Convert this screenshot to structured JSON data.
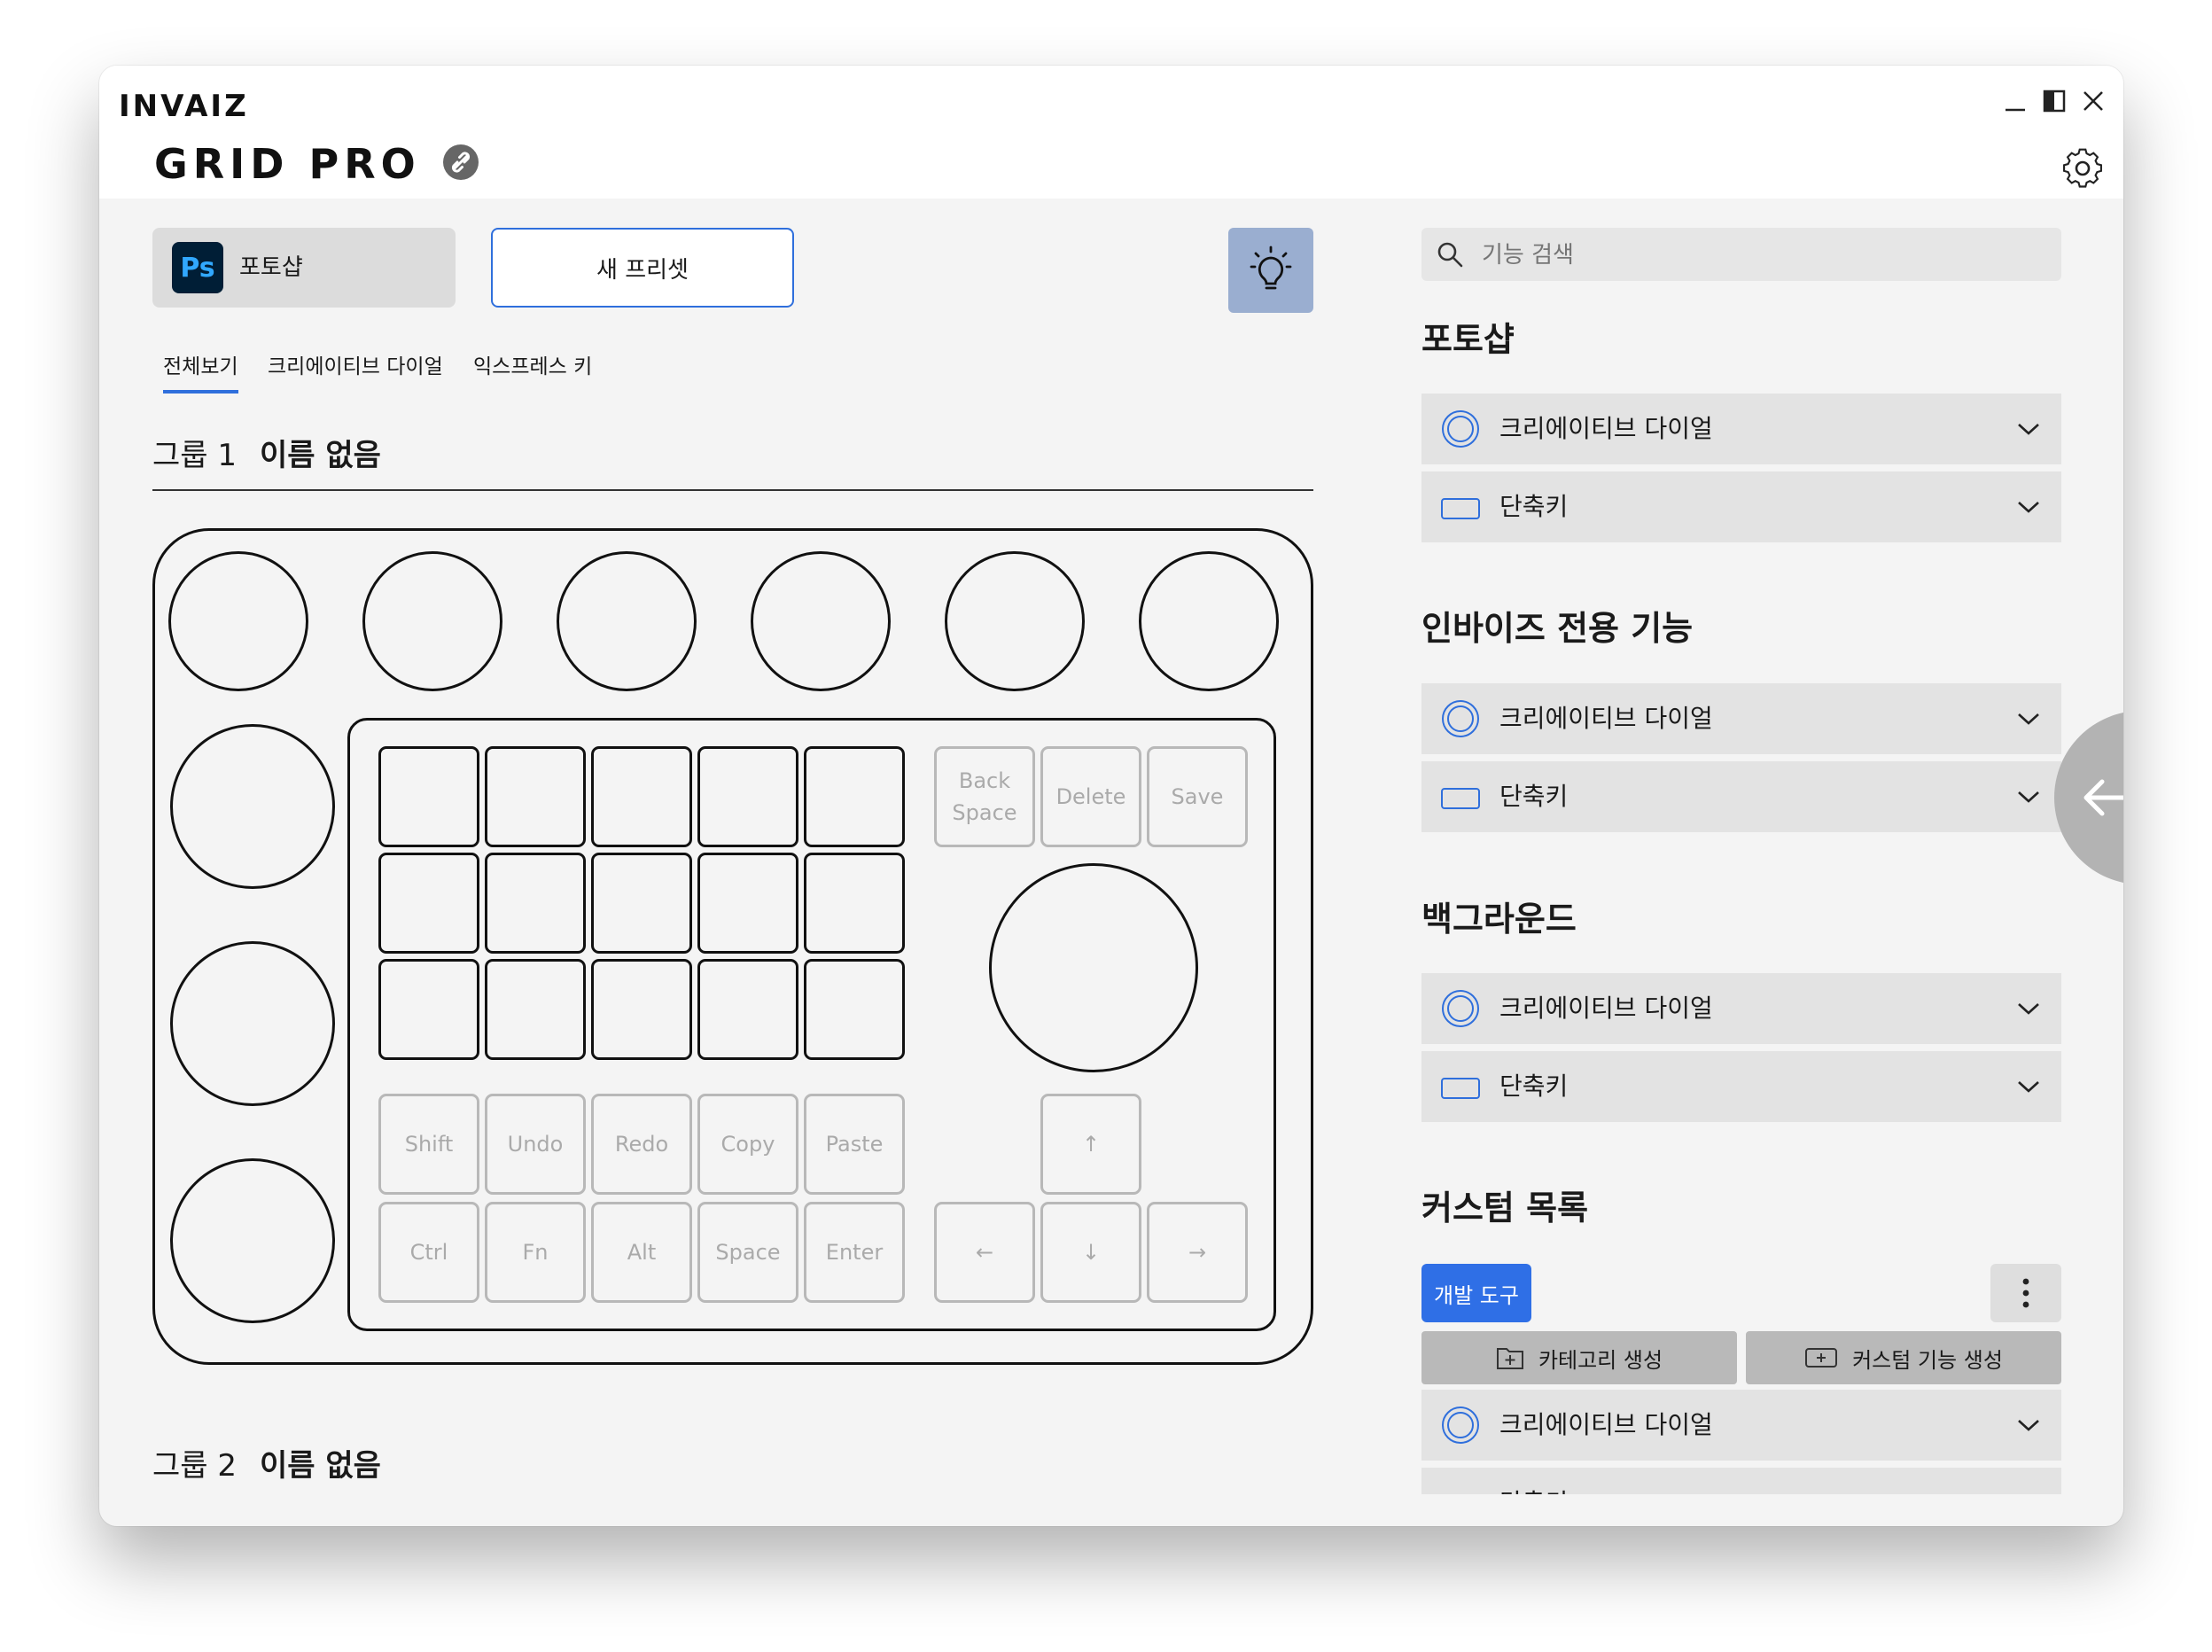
{
  "window": {
    "brand": "INVAIZ",
    "product": "GRID PRO"
  },
  "preset_bar": {
    "app_icon": "Ps",
    "app_label": "포토샵",
    "new_preset_label": "새 프리셋"
  },
  "tabs": [
    {
      "label": "전체보기",
      "active": true
    },
    {
      "label": "크리에이티브 다이얼",
      "active": false
    },
    {
      "label": "익스프레스 키",
      "active": false
    }
  ],
  "groups": [
    {
      "prefix": "그룹 1",
      "name": "이름 없음"
    },
    {
      "prefix": "그룹 2",
      "name": "이름 없음"
    }
  ],
  "device": {
    "function_keys": {
      "backspace": "Back\nSpace",
      "delete": "Delete",
      "save": "Save",
      "shift": "Shift",
      "undo": "Undo",
      "redo": "Redo",
      "copy": "Copy",
      "paste": "Paste",
      "ctrl": "Ctrl",
      "fn": "Fn",
      "alt": "Alt",
      "space": "Space",
      "enter": "Enter",
      "up": "↑",
      "left": "←",
      "down": "↓",
      "right": "→"
    }
  },
  "search": {
    "placeholder": "기능 검색"
  },
  "sections": [
    {
      "title": "포토샵",
      "rows": [
        {
          "icon": "dial-icon",
          "label": "크리에이티브 다이얼"
        },
        {
          "icon": "key-icon",
          "label": "단축키"
        }
      ]
    },
    {
      "title": "인바이즈 전용 기능",
      "rows": [
        {
          "icon": "dial-icon",
          "label": "크리에이티브 다이얼"
        },
        {
          "icon": "key-icon",
          "label": "단축키"
        }
      ]
    },
    {
      "title": "백그라운드",
      "rows": [
        {
          "icon": "dial-icon",
          "label": "크리에이티브 다이얼"
        },
        {
          "icon": "key-icon",
          "label": "단축키"
        }
      ]
    },
    {
      "title": "커스텀 목록",
      "rows": [
        {
          "icon": "dial-icon",
          "label": "크리에이티브 다이얼"
        },
        {
          "icon": "key-icon",
          "label": "단축키"
        }
      ]
    }
  ],
  "custom": {
    "dev_tools_label": "개발 도구",
    "create_category_label": "카테고리 생성",
    "create_custom_label": "커스텀 기능 생성"
  },
  "colors": {
    "accent": "#2f6fdc",
    "button_blue": "#2f6fe6",
    "tip_button": "#9aaed0",
    "photoshop_bg": "#001e36",
    "photoshop_fg": "#31a8ff"
  }
}
